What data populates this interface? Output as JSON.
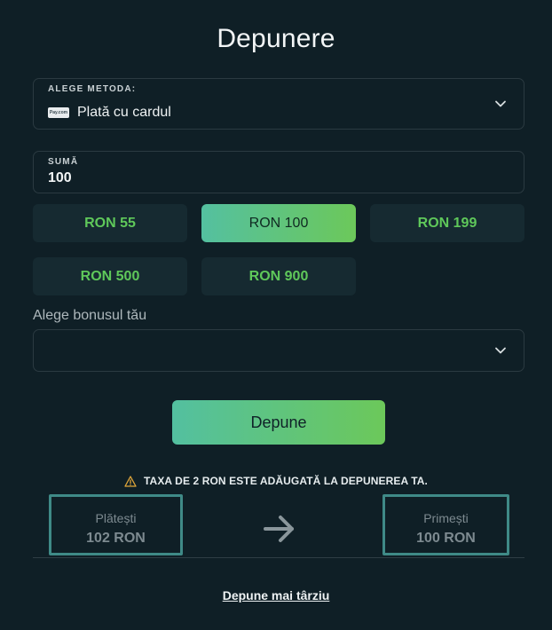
{
  "title": "Depunere",
  "method": {
    "label": "ALEGE METODA:",
    "value": "Plată cu cardul",
    "icon_text": "Pay.com",
    "icon": "card-payment-icon"
  },
  "amount": {
    "label": "SUMĂ",
    "value": "100"
  },
  "presets": [
    {
      "label": "RON 55",
      "active": false
    },
    {
      "label": "RON 100",
      "active": true
    },
    {
      "label": "RON 199",
      "active": false
    },
    {
      "label": "RON 500",
      "active": false
    },
    {
      "label": "RON 900",
      "active": false
    }
  ],
  "bonus": {
    "label": "Alege bonusul tău",
    "value": ""
  },
  "deposit_button": "Depune",
  "fee_notice": "TAXA DE 2 RON ESTE ADĂUGATĂ LA DEPUNEREA TA.",
  "summary": {
    "pay_label": "Plătești",
    "pay_value": "102 RON",
    "receive_label": "Primești",
    "receive_value": "100 RON"
  },
  "later_link": "Depune mai târziu",
  "colors": {
    "background": "#0f1f26",
    "accent_start": "#54c0a0",
    "accent_end": "#6cc85a",
    "preset_text": "#5fc85a",
    "summary_border": "#3f8a87",
    "warning": "#e0a63a"
  }
}
